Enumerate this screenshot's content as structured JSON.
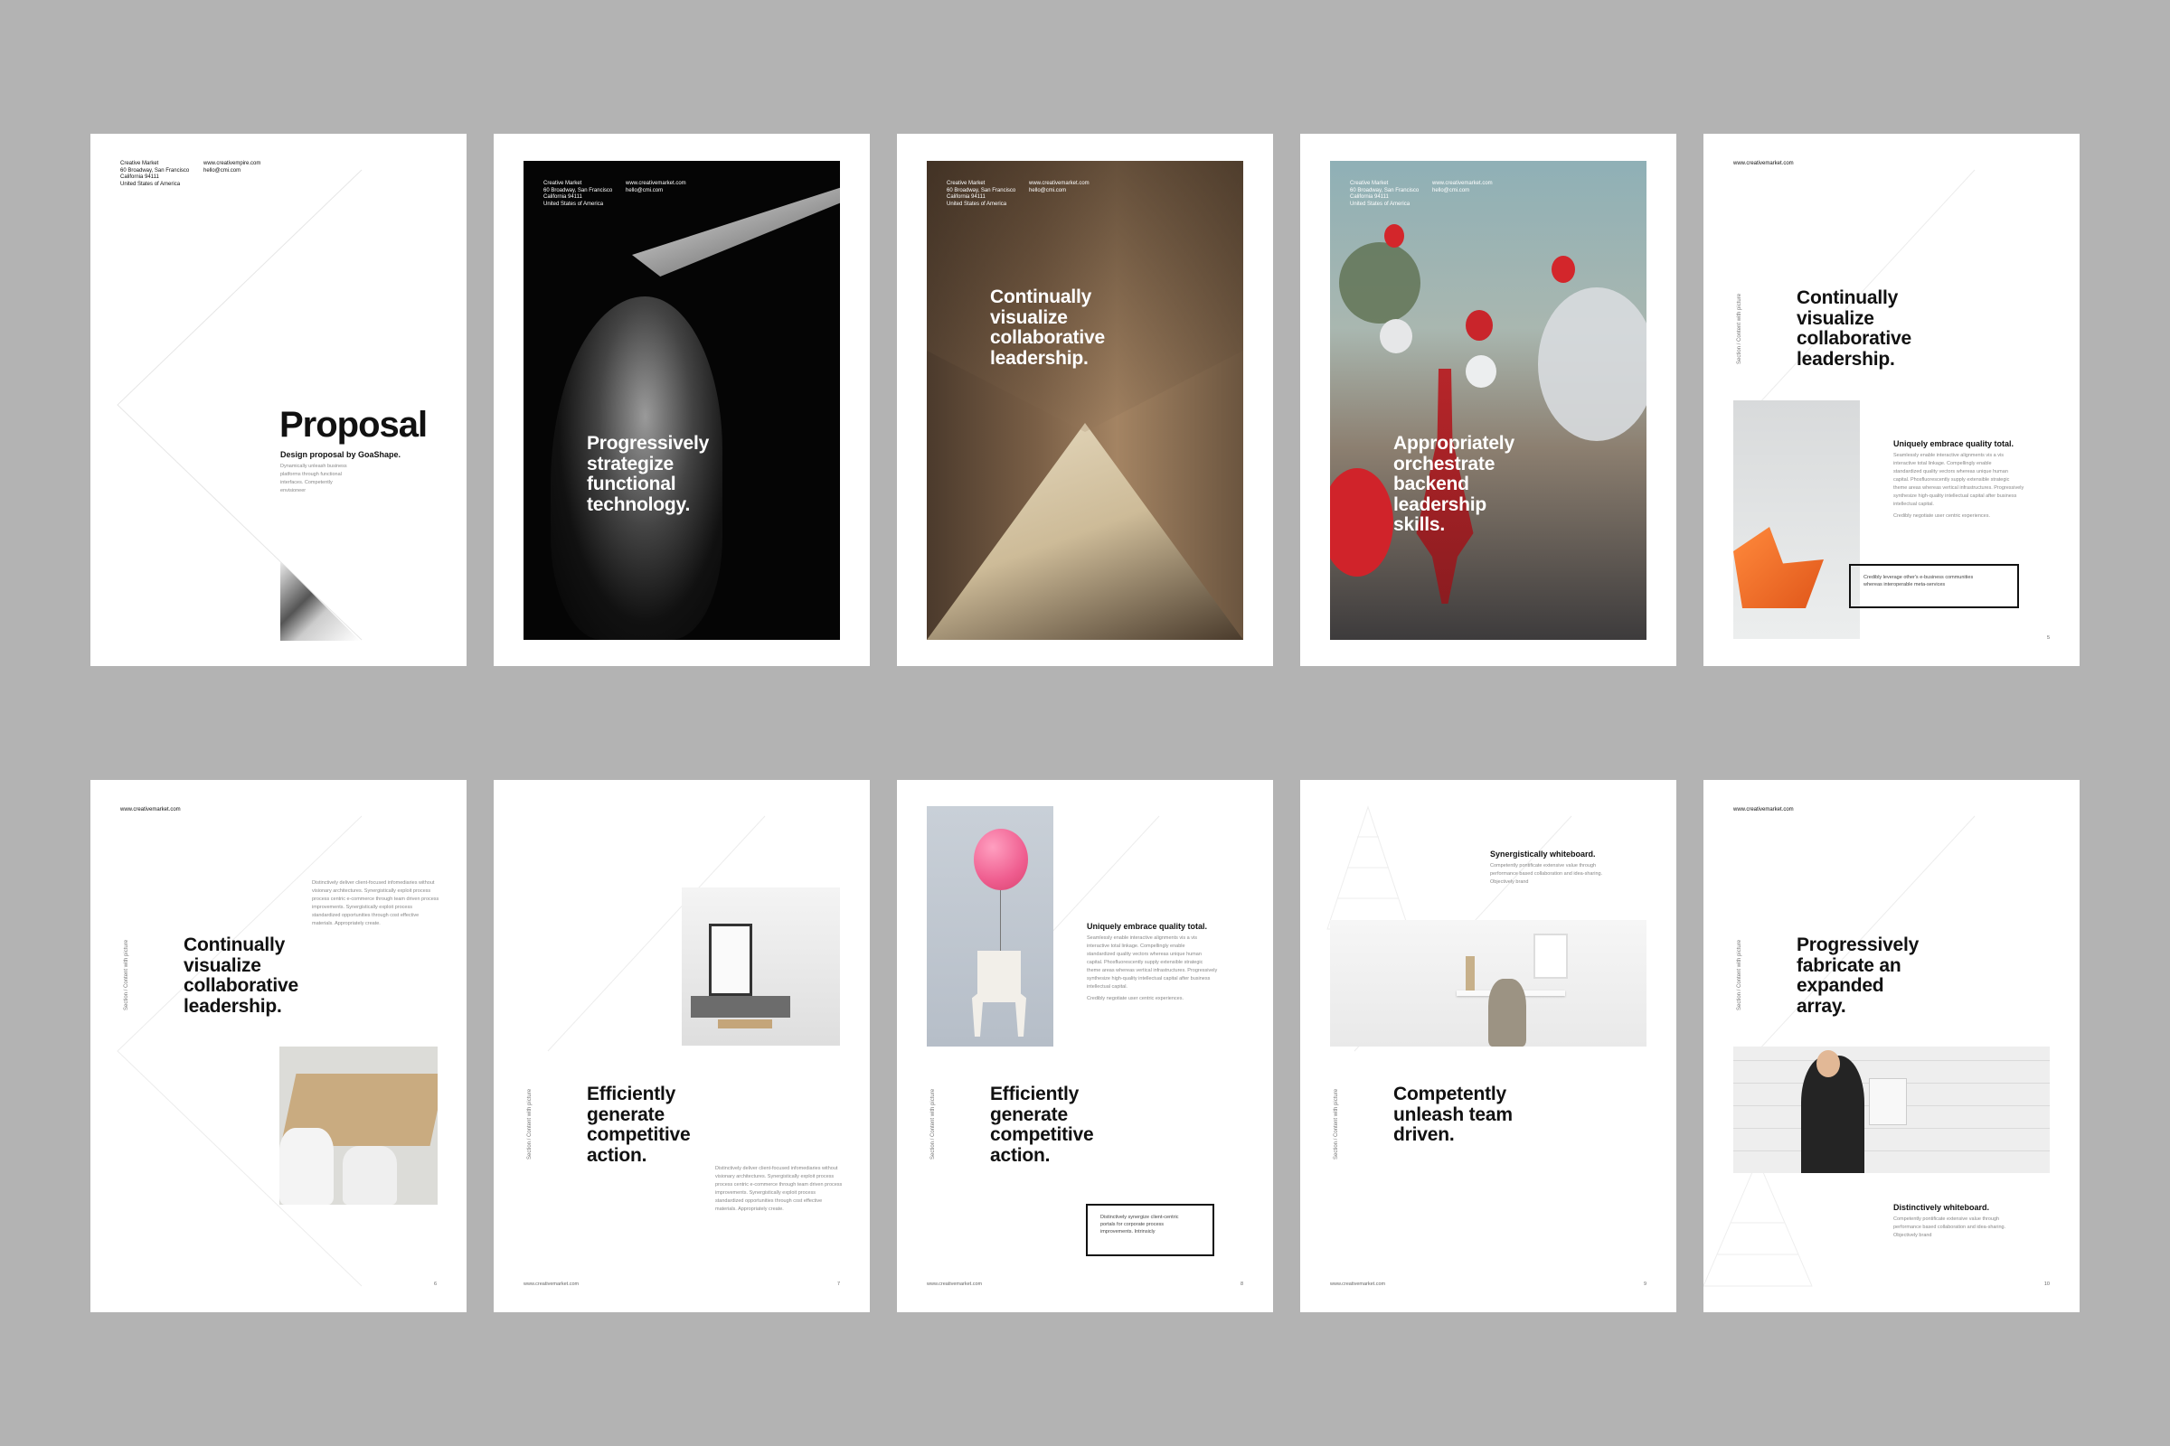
{
  "company": {
    "name": "Creative Market",
    "street": "60 Broadway, San Francisco",
    "state": "California 94111",
    "country": "United States of America",
    "website": "www.creativemarket.com",
    "website_alt": "www.creativempire.com",
    "email": "hello@cmi.com"
  },
  "section_label": "Section / Content with picture",
  "pages": {
    "cover": {
      "title": "Proposal",
      "subtitle": "Design proposal by GoaShape.",
      "desc": [
        "Dynamically unleash business",
        "platforms through functional",
        "interfaces. Competently",
        "envisioneer"
      ]
    },
    "p2": {
      "headline": [
        "Progressively",
        "strategize",
        "functional",
        "technology."
      ]
    },
    "p3": {
      "headline": [
        "Continually",
        "visualize",
        "collaborative",
        "leadership."
      ]
    },
    "p4": {
      "headline": [
        "Appropriately",
        "orchestrate",
        "backend",
        "leadership",
        "skills."
      ]
    },
    "p5": {
      "headline": [
        "Continually",
        "visualize",
        "collaborative",
        "leadership."
      ],
      "subhead": "Uniquely embrace quality total.",
      "body": [
        "Seamlessly enable interactive alignments vis a vis",
        "interactive total linkage. Compellingly enable",
        "standardized quality vectors whereas unique human",
        "capital. Phosfluorescently supply extensible strategic",
        "theme areas whereas vertical infrastructures. Progressively",
        "synthesize high-quality intellectual capital after business",
        "intellectual capital.",
        "Credibly negotiate user centric experiences."
      ],
      "box": [
        "Credibly leverage other's e-business communities",
        "whereas interoperable meta-services"
      ],
      "page_num": "5"
    },
    "p6": {
      "headline": [
        "Continually",
        "visualize",
        "collaborative",
        "leadership."
      ],
      "body": [
        "Distinctively deliver client-focused infomediaries without",
        "visionary architectures. Synergistically exploit process",
        "process centric e-commerce through team driven process",
        "improvements. Synergistically exploit process",
        "standardized opportunities through cost effective",
        "materials. Appropriately create."
      ],
      "page_num": "6"
    },
    "p7": {
      "headline": [
        "Efficiently",
        "generate",
        "competitive",
        "action."
      ],
      "body": [
        "Distinctively deliver client-focused infomediaries without",
        "visionary architectures. Synergistically exploit process",
        "process centric e-commerce through team driven process",
        "improvements. Synergistically exploit process",
        "standardized opportunities through cost effective",
        "materials. Appropriately create."
      ],
      "page_num": "7"
    },
    "p8": {
      "headline": [
        "Efficiently",
        "generate",
        "competitive",
        "action."
      ],
      "subhead": "Uniquely embrace quality total.",
      "body": [
        "Seamlessly enable interactive alignments vis a vis",
        "interactive total linkage. Compellingly enable",
        "standardized quality vectors whereas unique human",
        "capital. Phosfluorescently supply extensible strategic",
        "theme areas whereas vertical infrastructures. Progressively",
        "synthesize high-quality intellectual capital after business",
        "intellectual capital.",
        "Credibly negotiate user centric experiences."
      ],
      "box": [
        "Distinctively synergize client-centric",
        "portals for corporate process",
        "improvements. Intrinsicly"
      ],
      "page_num": "8"
    },
    "p9": {
      "headline": [
        "Competently",
        "unleash team",
        "driven."
      ],
      "subhead": "Synergistically whiteboard.",
      "body": [
        "Competently pontificate extensive value through",
        "performance based collaboration and idea-sharing.",
        "Objectively brand"
      ],
      "page_num": "9"
    },
    "p10": {
      "headline": [
        "Progressively",
        "fabricate an",
        "expanded",
        "array."
      ],
      "subhead": "Distinctively whiteboard.",
      "body": [
        "Competently pontificate extensive value through",
        "performance based collaboration and idea-sharing.",
        "Objectively brand"
      ],
      "page_num": "10"
    }
  }
}
